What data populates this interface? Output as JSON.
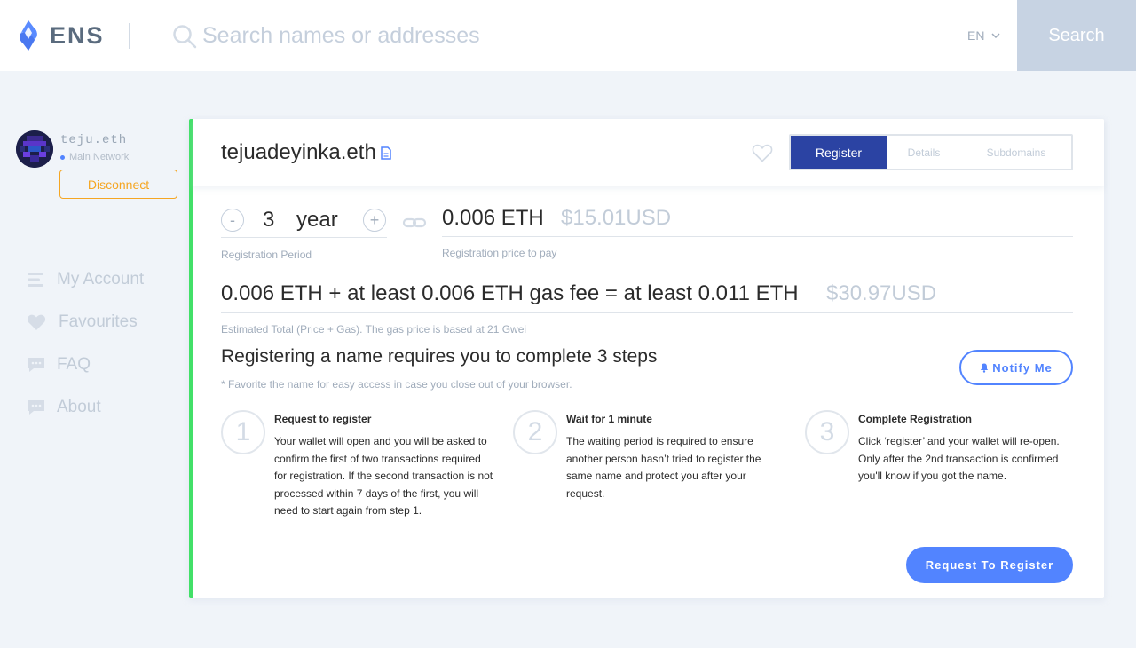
{
  "header": {
    "logo_text": "ENS",
    "search_placeholder": "Search names or addresses",
    "language": "EN",
    "search_button": "Search"
  },
  "account": {
    "name": "teju.eth",
    "network": "Main Network",
    "disconnect_label": "Disconnect"
  },
  "nav": {
    "items": [
      {
        "label": "My Account",
        "icon": "account-icon"
      },
      {
        "label": "Favourites",
        "icon": "heart-icon"
      },
      {
        "label": "FAQ",
        "icon": "chat-icon"
      },
      {
        "label": "About",
        "icon": "chat-icon"
      }
    ]
  },
  "domain": {
    "name": "tejuadeyinka.eth",
    "tabs": [
      "Register",
      "Details",
      "Subdomains"
    ],
    "active_tab": "Register"
  },
  "registration": {
    "minus": "-",
    "plus": "+",
    "period_value": "3",
    "period_unit": "year",
    "period_label": "Registration Period",
    "price_eth": "0.006 ETH",
    "price_usd": "$15.01USD",
    "price_label": "Registration price to pay",
    "total_eth": "0.006 ETH + at least 0.006 ETH gas fee = at least 0.011 ETH",
    "total_usd": "$30.97USD",
    "total_label": "Estimated Total (Price + Gas). The gas price is based at 21 Gwei"
  },
  "steps": {
    "title": "Registering a name requires you to complete 3 steps",
    "note": "* Favorite the name for easy access in case you close out of your browser.",
    "notify_label": "Notify Me",
    "items": [
      {
        "num": "1",
        "title": "Request to register",
        "body": "Your wallet will open and you will be asked to confirm the first of two transactions required for registration. If the second transaction is not processed within 7 days of the first, you will need to start again from step 1."
      },
      {
        "num": "2",
        "title": "Wait for 1 minute",
        "body": "The waiting period is required to ensure another person hasn’t tried to register the same name and protect you after your request."
      },
      {
        "num": "3",
        "title": "Complete Registration",
        "body": "Click ‘register’ and your wallet will re-open. Only after the 2nd transaction is confirmed you'll know if you got the name."
      }
    ],
    "request_button": "Request To Register"
  },
  "colors": {
    "accent_blue": "#5284ff",
    "tab_active": "#2b43a3",
    "card_border": "#42e068",
    "disconnect": "#f5a623",
    "search_button": "#c7d3e3"
  }
}
